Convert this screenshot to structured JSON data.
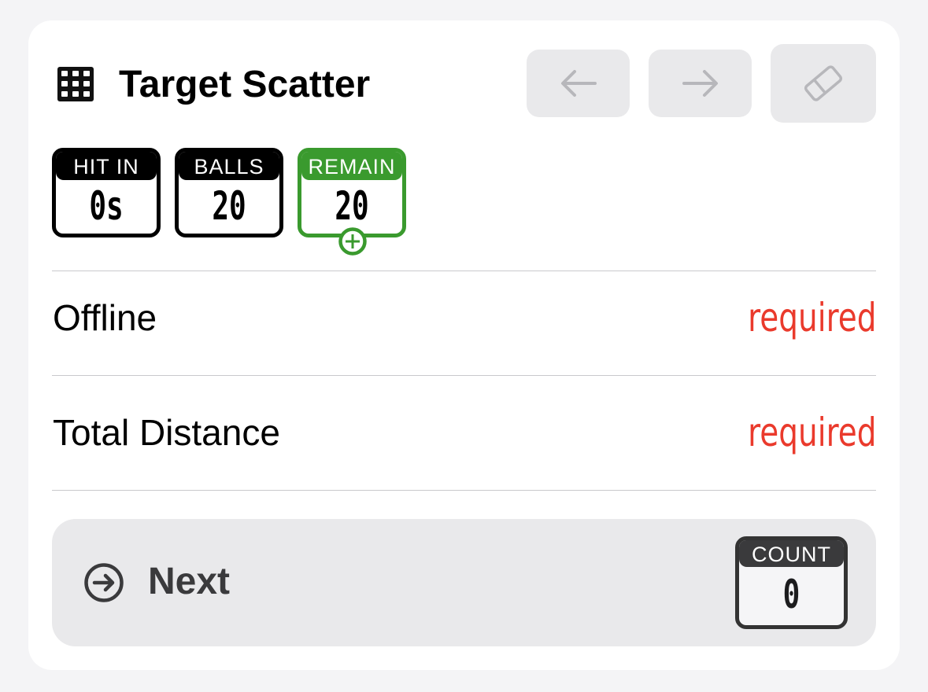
{
  "header": {
    "title": "Target Scatter",
    "icon": "grid-icon",
    "buttons": {
      "prev_icon": "arrow-left-icon",
      "next_icon": "arrow-right-icon",
      "erase_icon": "eraser-icon"
    }
  },
  "stats": [
    {
      "label": "HIT IN",
      "value": "0s",
      "color": "#000000"
    },
    {
      "label": "BALLS",
      "value": "20",
      "color": "#000000"
    },
    {
      "label": "REMAIN",
      "value": "20",
      "color": "#3a9a2e"
    }
  ],
  "rows": [
    {
      "label": "Offline",
      "value": "required"
    },
    {
      "label": "Total Distance",
      "value": "required"
    }
  ],
  "next": {
    "label": "Next",
    "icon": "arrow-right-circle-icon",
    "count_label": "COUNT",
    "count_value": "0"
  },
  "colors": {
    "required": "#ea3a2c",
    "accent_green": "#3a9a2e",
    "button_bg": "#e9e9eb"
  }
}
